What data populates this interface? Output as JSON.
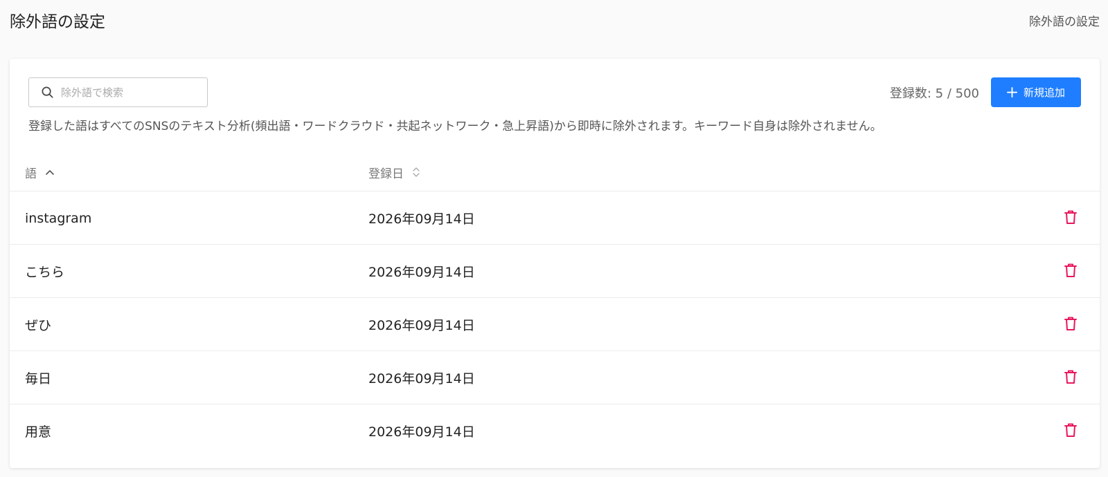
{
  "header": {
    "title": "除外語の設定",
    "breadcrumb": "除外語の設定"
  },
  "toolbar": {
    "search_placeholder": "除外語で検索",
    "search_value": "",
    "count_text": "登録数: 5 / 500",
    "add_label": "新規追加"
  },
  "description": "登録した語はすべてのSNSのテキスト分析(頻出語・ワードクラウド・共起ネットワーク・急上昇語)から即時に除外されます。キーワード自身は除外されません。",
  "table": {
    "columns": [
      "語",
      "登録日"
    ],
    "sort": {
      "column": "語",
      "direction": "asc"
    },
    "rows": [
      {
        "word": "instagram",
        "date": "2026年09月14日"
      },
      {
        "word": "こちら",
        "date": "2026年09月14日"
      },
      {
        "word": "ぜひ",
        "date": "2026年09月14日"
      },
      {
        "word": "毎日",
        "date": "2026年09月14日"
      },
      {
        "word": "用意",
        "date": "2026年09月14日"
      }
    ]
  },
  "colors": {
    "accent": "#1f7eff",
    "danger": "#e8175d",
    "text": "#222222",
    "muted": "#777777"
  },
  "icons": {
    "search": "search-icon",
    "add": "plus-icon",
    "sort_active": "chevron-up-icon",
    "sort_inactive": "sort-icon",
    "delete": "trash-icon"
  }
}
